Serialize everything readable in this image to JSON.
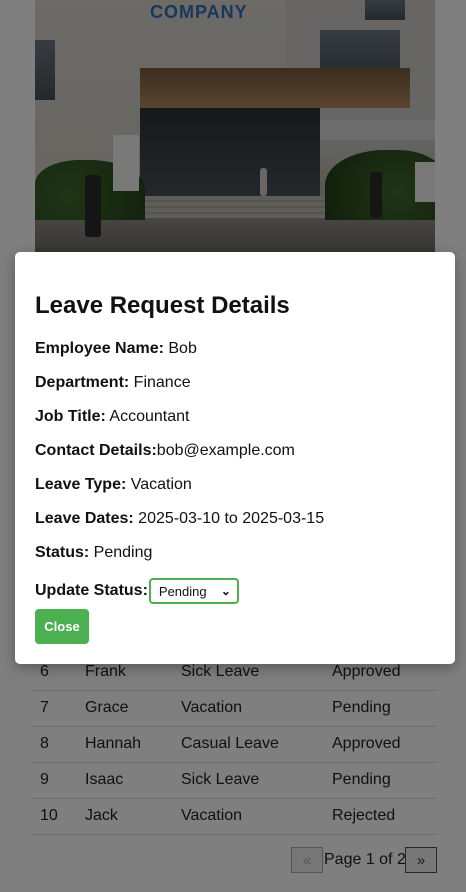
{
  "hero": {
    "logo_text": "COMPANY"
  },
  "modal": {
    "title": "Leave Request Details",
    "fields": [
      {
        "label": "Employee Name:",
        "value": " Bob"
      },
      {
        "label": "Department:",
        "value": " Finance"
      },
      {
        "label": "Job Title:",
        "value": " Accountant"
      },
      {
        "label": "Contact Details:",
        "value": "bob@example.com"
      },
      {
        "label": "Leave Type:",
        "value": " Vacation"
      },
      {
        "label": "Leave Dates:",
        "value": " 2025-03-10 to 2025-03-15"
      },
      {
        "label": "Status:",
        "value": " Pending"
      }
    ],
    "update_label": "Update Status:",
    "status_selected": "Pending",
    "close_label": "Close"
  },
  "table": {
    "rows": [
      {
        "id": "6",
        "name": "Frank",
        "type": "Sick Leave",
        "status": "Approved"
      },
      {
        "id": "7",
        "name": "Grace",
        "type": "Vacation",
        "status": "Pending"
      },
      {
        "id": "8",
        "name": "Hannah",
        "type": "Casual Leave",
        "status": "Approved"
      },
      {
        "id": "9",
        "name": "Isaac",
        "type": "Sick Leave",
        "status": "Pending"
      },
      {
        "id": "10",
        "name": "Jack",
        "type": "Vacation",
        "status": "Rejected"
      }
    ]
  },
  "pagination": {
    "text": "Page 1 of 2",
    "prev_icon": "chevrons-left-icon",
    "next_icon": "chevrons-right-icon"
  },
  "colors": {
    "accent": "#4caf50",
    "overlay": "rgba(0,0,0,0.5)"
  }
}
